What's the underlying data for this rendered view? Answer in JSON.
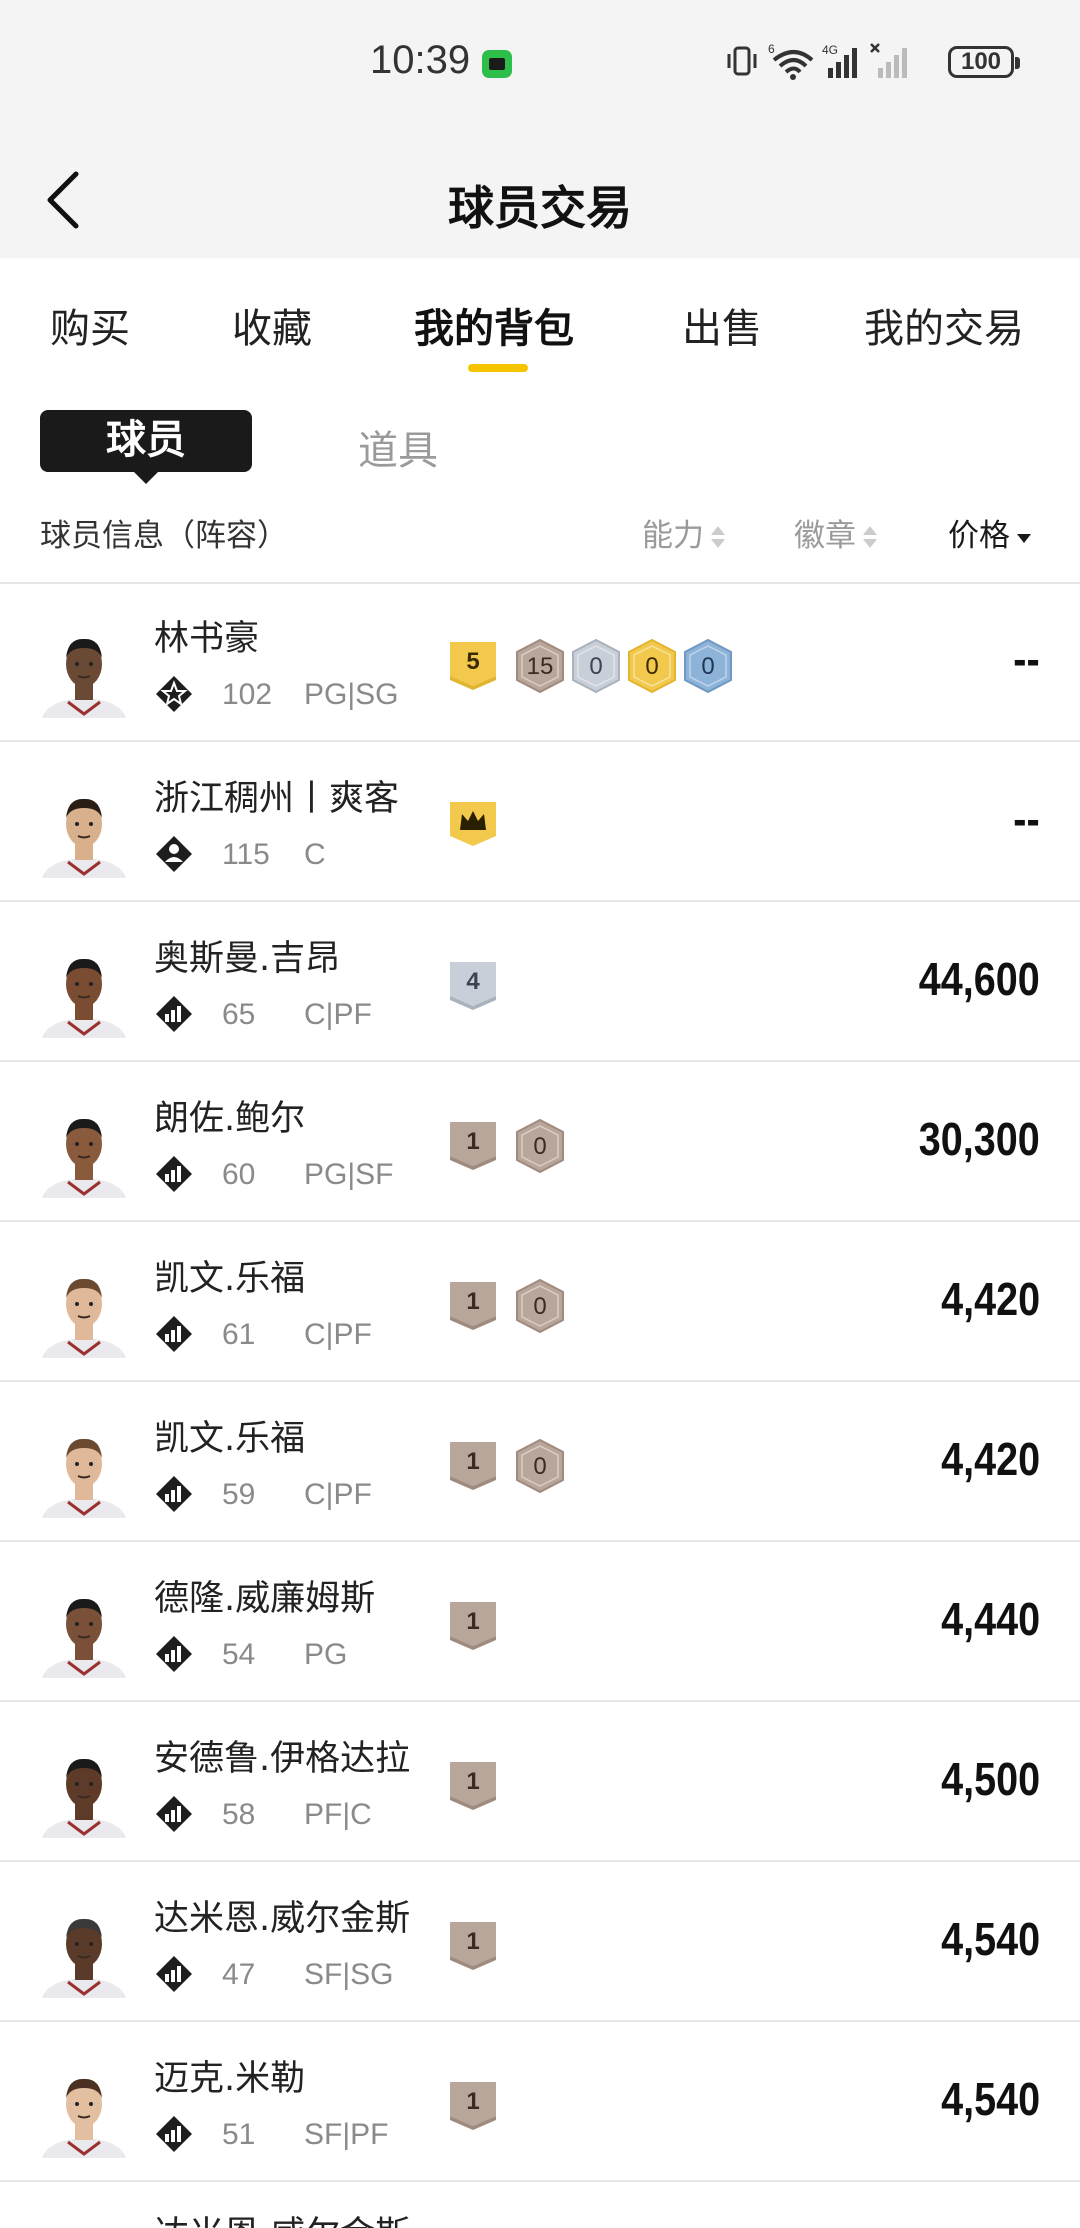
{
  "status_bar": {
    "time": "10:39",
    "battery": "100",
    "network_label": "4G",
    "wifi_label": "6"
  },
  "header": {
    "title": "球员交易"
  },
  "tabs": [
    {
      "label": "购买"
    },
    {
      "label": "收藏"
    },
    {
      "label": "我的背包",
      "active": true
    },
    {
      "label": "出售"
    },
    {
      "label": "我的交易"
    }
  ],
  "segments": {
    "active": "球员",
    "inactive": "道具"
  },
  "columns": {
    "info": "球员信息（阵容）",
    "ability": "能力",
    "badge": "徽章",
    "price": "价格"
  },
  "colors": {
    "accent": "#f5c400",
    "gold": "#f2c94c",
    "bronze": "#b9a69a",
    "silver": "#c9cfd8",
    "sapphire": "#7fa9d4"
  },
  "players": [
    {
      "name": "林书豪",
      "rating": "102",
      "position": "PG|SG",
      "icon": "star-rank-icon",
      "badges": [
        {
          "type": "level-shield",
          "tier": "gold",
          "text": "5"
        },
        {
          "type": "hex",
          "tier": "bronze",
          "text": "15"
        },
        {
          "type": "hex",
          "tier": "silver",
          "text": "0"
        },
        {
          "type": "hex",
          "tier": "gold",
          "text": "0"
        },
        {
          "type": "hex",
          "tier": "sapphire",
          "text": "0"
        }
      ],
      "price": "--"
    },
    {
      "name": "浙江稠州丨爽客",
      "rating": "115",
      "position": "C",
      "icon": "person-rank-icon",
      "badges": [
        {
          "type": "crown-shield",
          "tier": "gold",
          "text": ""
        }
      ],
      "price": "--"
    },
    {
      "name": "奥斯曼.吉昂",
      "rating": "65",
      "position": "C|PF",
      "icon": "bars-rank-icon",
      "badges": [
        {
          "type": "level-shield",
          "tier": "silver",
          "text": "4"
        }
      ],
      "price": "44,600"
    },
    {
      "name": "朗佐.鲍尔",
      "rating": "60",
      "position": "PG|SF",
      "icon": "bars-rank-icon",
      "badges": [
        {
          "type": "level-shield",
          "tier": "bronze",
          "text": "1"
        },
        {
          "type": "hex",
          "tier": "bronze",
          "text": "0"
        }
      ],
      "price": "30,300"
    },
    {
      "name": "凯文.乐福",
      "rating": "61",
      "position": "C|PF",
      "icon": "bars-rank-icon",
      "badges": [
        {
          "type": "level-shield",
          "tier": "bronze",
          "text": "1"
        },
        {
          "type": "hex",
          "tier": "bronze",
          "text": "0"
        }
      ],
      "price": "4,420"
    },
    {
      "name": "凯文.乐福",
      "rating": "59",
      "position": "C|PF",
      "icon": "bars-rank-icon",
      "badges": [
        {
          "type": "level-shield",
          "tier": "bronze",
          "text": "1"
        },
        {
          "type": "hex",
          "tier": "bronze",
          "text": "0"
        }
      ],
      "price": "4,420"
    },
    {
      "name": "德隆.威廉姆斯",
      "rating": "54",
      "position": "PG",
      "icon": "bars-rank-icon",
      "badges": [
        {
          "type": "level-shield",
          "tier": "bronze",
          "text": "1"
        }
      ],
      "price": "4,440"
    },
    {
      "name": "安德鲁.伊格达拉",
      "rating": "58",
      "position": "PF|C",
      "icon": "bars-rank-icon",
      "badges": [
        {
          "type": "level-shield",
          "tier": "bronze",
          "text": "1"
        }
      ],
      "price": "4,500"
    },
    {
      "name": "达米恩.威尔金斯",
      "rating": "47",
      "position": "SF|SG",
      "icon": "bars-rank-icon",
      "badges": [
        {
          "type": "level-shield",
          "tier": "bronze",
          "text": "1"
        }
      ],
      "price": "4,540"
    },
    {
      "name": "迈克.米勒",
      "rating": "51",
      "position": "SF|PF",
      "icon": "bars-rank-icon",
      "badges": [
        {
          "type": "level-shield",
          "tier": "bronze",
          "text": "1"
        }
      ],
      "price": "4,540"
    }
  ],
  "partial_row": {
    "name": "达米恩.威尔金斯"
  }
}
